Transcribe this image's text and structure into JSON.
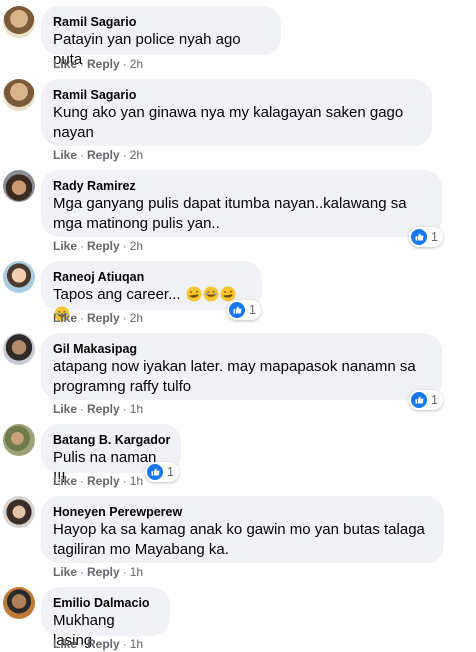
{
  "actions": {
    "like": "Like",
    "reply": "Reply",
    "dot": "·"
  },
  "comments": [
    {
      "name": "Ramil Sagario",
      "lines": [
        "Patayin yan police nyah ago puta"
      ],
      "time": "2h",
      "reactions": null
    },
    {
      "name": "Ramil Sagario",
      "lines": [
        "Kung ako yan ginawa nya my kalagayan saken gago",
        "nayan"
      ],
      "time": "2h",
      "reactions": null
    },
    {
      "name": "Rady Ramirez",
      "lines": [
        "Mga ganyang pulis dapat itumba nayan..kalawang sa",
        "mga matinong pulis yan.."
      ],
      "time": "2h",
      "reactions": "1"
    },
    {
      "name": "Raneoj Atiuqan",
      "lines": [
        "Tapos ang career..."
      ],
      "time": "2h",
      "reactions": "1"
    },
    {
      "name": "Gil Makasipag",
      "lines": [
        "atapang now iyakan later. may mapapasok nanamn sa",
        "programng raffy tulfo"
      ],
      "time": "1h",
      "reactions": "1"
    },
    {
      "name": "Batang B. Kargador",
      "lines": [
        "Pulis na naman !!!"
      ],
      "time": "1h",
      "reactions": "1"
    },
    {
      "name": "Honeyen Perewperew",
      "lines": [
        "Hayop ka sa kamag anak ko gawin mo yan butas talaga",
        "tagiliran mo Mayabang ka."
      ],
      "time": "1h",
      "reactions": null
    },
    {
      "name": "Emilio Dalmacio",
      "lines": [
        "Mukhang lasing"
      ],
      "time": "1h",
      "reactions": null
    }
  ],
  "colors": {
    "like_blue": "#1877f2",
    "bubble": "#f0f2f5",
    "meta": "#65676b"
  }
}
